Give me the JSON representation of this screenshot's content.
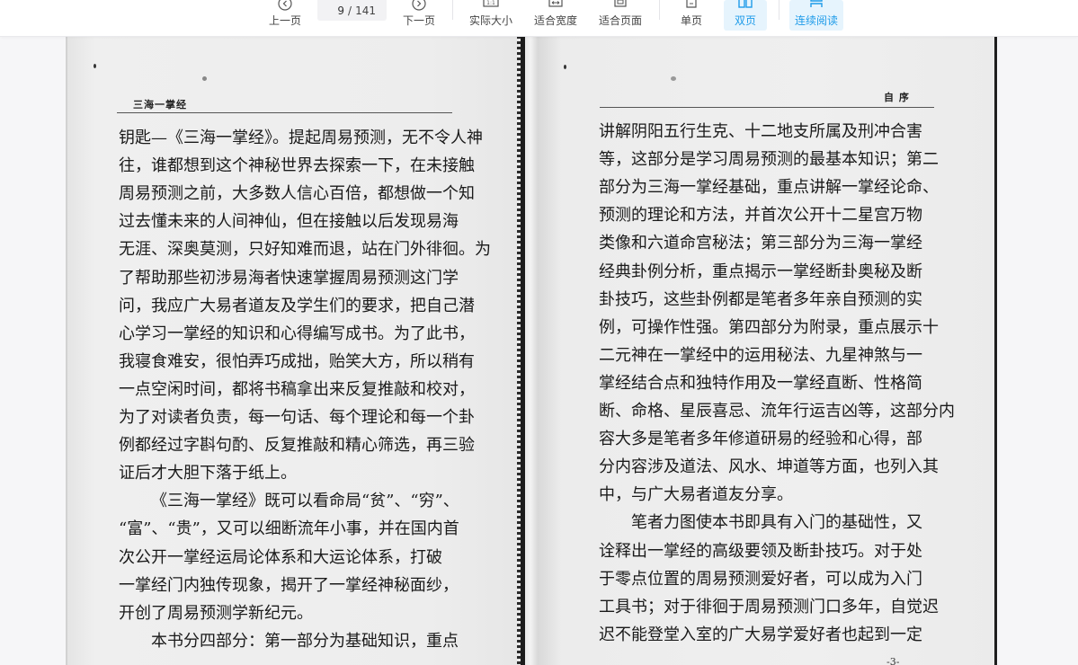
{
  "toolbar": {
    "prev_label": "上一页",
    "current_page": "9",
    "page_separator": "/",
    "total_pages": "141",
    "next_label": "下一页",
    "actual_size_label": "实际大小",
    "fit_width_label": "适合宽度",
    "fit_page_label": "适合页面",
    "single_page_label": "单页",
    "double_page_label": "双页",
    "continuous_label": "连续阅读",
    "accent_color": "#1e9be9"
  },
  "left_page": {
    "running_head": "三海一掌经",
    "lines": [
      "钥匙—《三海一掌经》。提起周易预测，无不令人神",
      "往，谁都想到这个神秘世界去探索一下，在未接触",
      "周易预测之前，大多数人信心百倍，都想做一个知",
      "过去懂未来的人间神仙，但在接触以后发现易海",
      "无涯、深奥莫测，只好知难而退，站在门外徘徊。为",
      "了帮助那些初涉易海者快速掌握周易预测这门学",
      "问，我应广大易者道友及学生们的要求，把自己潜",
      "心学习一掌经的知识和心得编写成书。为了此书，",
      "我寝食难安，很怕弄巧成拙，贻笑大方，所以稍有",
      "一点空闲时间，都将书稿拿出来反复推敲和校对，",
      "为了对读者负责，每一句话、每个理论和每一个卦",
      "例都经过字斟句酌、反复推敲和精心筛选，再三验",
      "证后才大胆下落于纸上。",
      "《三海一掌经》既可以看命局“贫”、“穷”、",
      "“富”、“贵”，又可以细断流年小事，并在国内首",
      "次公开一掌经运局论体系和大运论体系，打破",
      "一掌经门内独传现象，揭开了一掌经神秘面纱，",
      "开创了周易预测学新纪元。",
      "本书分四部分：第一部分为基础知识，重点"
    ]
  },
  "right_page": {
    "running_head": "自 序",
    "lines": [
      "讲解阴阳五行生克、十二地支所属及刑冲合害",
      "等，这部分是学习周易预测的最基本知识；第二",
      "部分为三海一掌经基础，重点讲解一掌经论命、",
      "预测的理论和方法，并首次公开十二星宫万物",
      "类像和六道命宫秘法；第三部分为三海一掌经",
      "经典卦例分析，重点揭示一掌经断卦奥秘及断",
      "卦技巧，这些卦例都是笔者多年亲自预测的实",
      "例，可操作性强。第四部分为附录，重点展示十",
      "二元神在一掌经中的运用秘法、九星神煞与一",
      "掌经结合点和独特作用及一掌经直断、性格简",
      "断、命格、星辰喜忌、流年行运吉凶等，这部分内",
      "容大多是笔者多年修道研易的经验和心得，部",
      "分内容涉及道法、风水、坤道等方面，也列入其",
      "中，与广大易者道友分享。",
      "笔者力图使本书即具有入门的基础性，又",
      "诠释出一掌经的高级要领及断卦技巧。对于处",
      "于零点位置的周易预测爱好者，可以成为入门",
      "工具书；对于徘徊于周易预测门口多年，自觉迟",
      "迟不能登堂入室的广大易学爱好者也起到一定"
    ],
    "page_number": "-3-"
  }
}
